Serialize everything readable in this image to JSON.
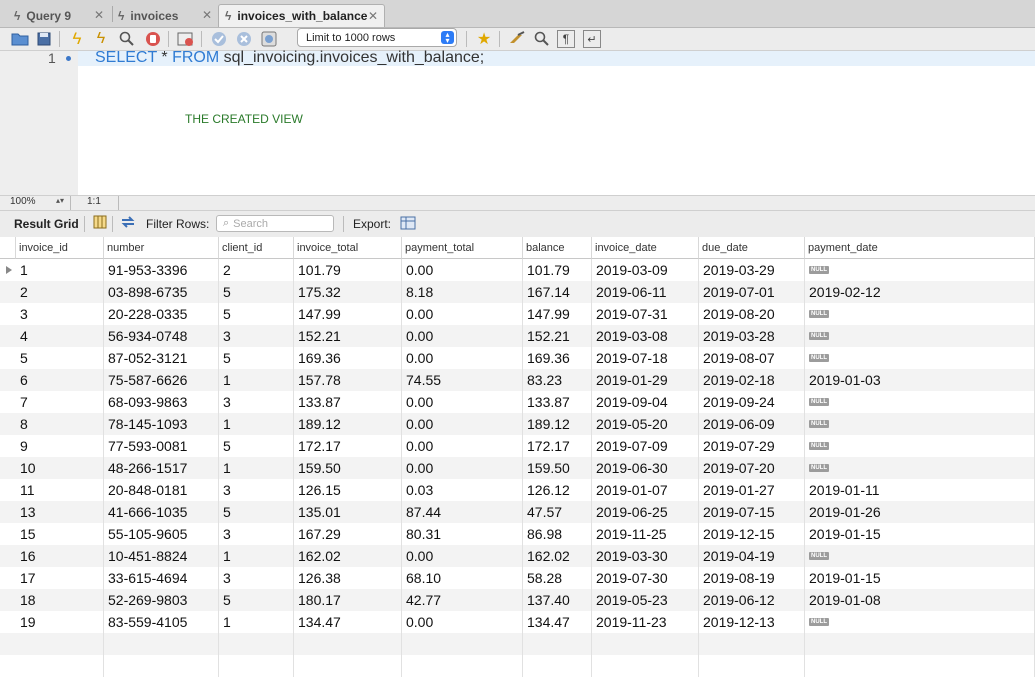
{
  "tabs": [
    {
      "label": "Query 9",
      "active": false
    },
    {
      "label": "invoices",
      "active": false
    },
    {
      "label": "invoices_with_balance",
      "active": true
    }
  ],
  "toolbar": {
    "icons": [
      "open-folder-icon",
      "save-icon",
      "execute-icon",
      "execute-current-icon",
      "explain-icon",
      "stop-icon",
      "toggle-error-icon",
      "commit-icon",
      "rollback-icon",
      "autocommit-icon",
      "bookmark-icon",
      "beautify-icon",
      "find-icon",
      "invisible-chars-icon",
      "wrap-icon"
    ],
    "limit_label": "Limit to 1000 rows"
  },
  "editor": {
    "line_number": "1",
    "code_keyword1": "SELECT",
    "code_mid": " * ",
    "code_keyword2": "FROM",
    "code_rest": " sql_invoicing.invoices_with_balance;",
    "comment": "THE CREATED VIEW"
  },
  "status": {
    "zoom": "100%",
    "position": "1:1"
  },
  "result_toolbar": {
    "result_grid": "Result Grid",
    "filter_rows": "Filter Rows:",
    "search_placeholder": "Search",
    "export": "Export:"
  },
  "grid": {
    "columns": [
      "invoice_id",
      "number",
      "client_id",
      "invoice_total",
      "payment_total",
      "balance",
      "invoice_date",
      "due_date",
      "payment_date"
    ],
    "null_label": "NULL",
    "rows": [
      [
        "1",
        "91-953-3396",
        "2",
        "101.79",
        "0.00",
        "101.79",
        "2019-03-09",
        "2019-03-29",
        null
      ],
      [
        "2",
        "03-898-6735",
        "5",
        "175.32",
        "8.18",
        "167.14",
        "2019-06-11",
        "2019-07-01",
        "2019-02-12"
      ],
      [
        "3",
        "20-228-0335",
        "5",
        "147.99",
        "0.00",
        "147.99",
        "2019-07-31",
        "2019-08-20",
        null
      ],
      [
        "4",
        "56-934-0748",
        "3",
        "152.21",
        "0.00",
        "152.21",
        "2019-03-08",
        "2019-03-28",
        null
      ],
      [
        "5",
        "87-052-3121",
        "5",
        "169.36",
        "0.00",
        "169.36",
        "2019-07-18",
        "2019-08-07",
        null
      ],
      [
        "6",
        "75-587-6626",
        "1",
        "157.78",
        "74.55",
        "83.23",
        "2019-01-29",
        "2019-02-18",
        "2019-01-03"
      ],
      [
        "7",
        "68-093-9863",
        "3",
        "133.87",
        "0.00",
        "133.87",
        "2019-09-04",
        "2019-09-24",
        null
      ],
      [
        "8",
        "78-145-1093",
        "1",
        "189.12",
        "0.00",
        "189.12",
        "2019-05-20",
        "2019-06-09",
        null
      ],
      [
        "9",
        "77-593-0081",
        "5",
        "172.17",
        "0.00",
        "172.17",
        "2019-07-09",
        "2019-07-29",
        null
      ],
      [
        "10",
        "48-266-1517",
        "1",
        "159.50",
        "0.00",
        "159.50",
        "2019-06-30",
        "2019-07-20",
        null
      ],
      [
        "11",
        "20-848-0181",
        "3",
        "126.15",
        "0.03",
        "126.12",
        "2019-01-07",
        "2019-01-27",
        "2019-01-11"
      ],
      [
        "13",
        "41-666-1035",
        "5",
        "135.01",
        "87.44",
        "47.57",
        "2019-06-25",
        "2019-07-15",
        "2019-01-26"
      ],
      [
        "15",
        "55-105-9605",
        "3",
        "167.29",
        "80.31",
        "86.98",
        "2019-11-25",
        "2019-12-15",
        "2019-01-15"
      ],
      [
        "16",
        "10-451-8824",
        "1",
        "162.02",
        "0.00",
        "162.02",
        "2019-03-30",
        "2019-04-19",
        null
      ],
      [
        "17",
        "33-615-4694",
        "3",
        "126.38",
        "68.10",
        "58.28",
        "2019-07-30",
        "2019-08-19",
        "2019-01-15"
      ],
      [
        "18",
        "52-269-9803",
        "5",
        "180.17",
        "42.77",
        "137.40",
        "2019-05-23",
        "2019-06-12",
        "2019-01-08"
      ],
      [
        "19",
        "83-559-4105",
        "1",
        "134.47",
        "0.00",
        "134.47",
        "2019-11-23",
        "2019-12-13",
        null
      ]
    ]
  }
}
